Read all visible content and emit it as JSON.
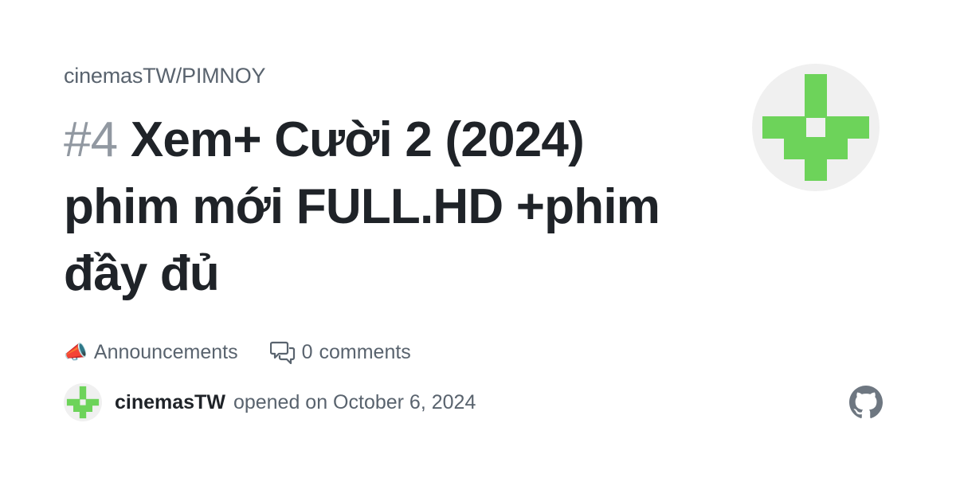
{
  "repository": "cinemasTW/PIMNOY",
  "issue": {
    "number": "#4",
    "title": "Xem+ Cười 2 (2024) phim mới FULL.HD +phim đầy đủ"
  },
  "meta": {
    "category_emoji": "📣",
    "category": "Announcements",
    "comments_count": "0",
    "comments_label": "comments"
  },
  "author": {
    "name": "cinemasTW",
    "opened_text": "opened on October 6, 2024"
  },
  "colors": {
    "identicon": "#6dd35a",
    "avatar_bg": "#f0f0f0",
    "github_logo": "#6e7781"
  },
  "icons": {
    "comments": "comment-discussion-icon",
    "github": "github-mark-icon"
  }
}
